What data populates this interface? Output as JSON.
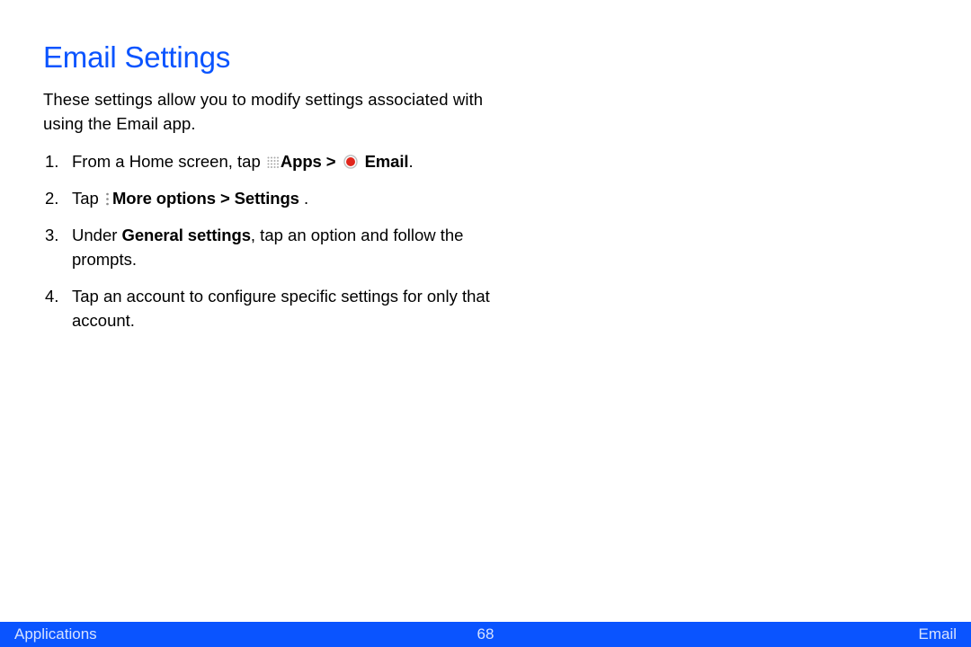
{
  "heading": "Email Settings",
  "intro": "These settings allow you to modify settings associated with using the Email app.",
  "step1": {
    "pre": "From a Home screen, tap ",
    "apps": "Apps > ",
    "emailLabel": " Email",
    "end": "."
  },
  "step2": {
    "pre": "Tap ",
    "opts": "More options > Settings",
    "end": " ."
  },
  "step3": {
    "pre": "Under ",
    "gs": "General settings",
    "post": ", tap an option and follow the prompts."
  },
  "step4": "Tap an account to configure specific settings for only that account.",
  "footer": {
    "left": "Applications",
    "center": "68",
    "right": "Email"
  }
}
